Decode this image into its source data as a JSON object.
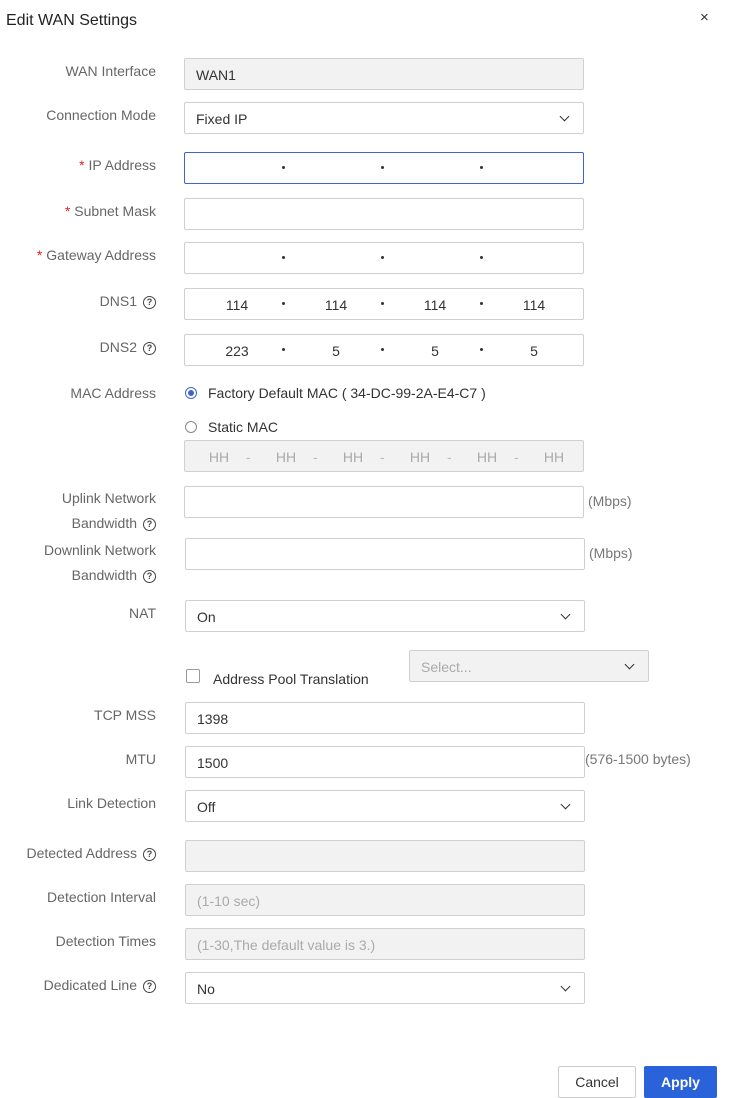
{
  "dialog": {
    "title": "Edit WAN Settings",
    "close_glyph": "×"
  },
  "fields": {
    "wan_interface": {
      "label": "WAN Interface",
      "value": "WAN1"
    },
    "connection_mode": {
      "label": "Connection Mode",
      "value": "Fixed IP"
    },
    "ip_address": {
      "required": "*",
      "label": "IP Address",
      "octets": [
        "",
        "",
        "",
        ""
      ]
    },
    "subnet_mask": {
      "required": "*",
      "label": "Subnet Mask",
      "value": ""
    },
    "gateway": {
      "required": "*",
      "label": "Gateway Address",
      "octets": [
        "",
        "",
        "",
        ""
      ]
    },
    "dns1": {
      "label": "DNS1",
      "help": "?",
      "octets": [
        "114",
        "114",
        "114",
        "114"
      ]
    },
    "dns2": {
      "label": "DNS2",
      "help": "?",
      "octets": [
        "223",
        "5",
        "5",
        "5"
      ]
    },
    "mac": {
      "label": "MAC Address",
      "option_default": "Factory Default MAC ( 34-DC-99-2A-E4-C7 )",
      "option_static": "Static MAC",
      "selected": "default",
      "placeholders": [
        "HH",
        "HH",
        "HH",
        "HH",
        "HH",
        "HH"
      ],
      "separator": "-"
    },
    "uplink": {
      "label_line1": "Uplink Network",
      "label_line2": "Bandwidth",
      "help": "?",
      "value": "",
      "unit": "(Mbps)"
    },
    "downlink": {
      "label_line1": "Downlink Network",
      "label_line2": "Bandwidth",
      "help": "?",
      "value": "",
      "unit": "(Mbps)"
    },
    "nat": {
      "label": "NAT",
      "value": "On"
    },
    "address_pool": {
      "label": "Address Pool Translation",
      "checked": false,
      "select_placeholder": "Select..."
    },
    "tcp_mss": {
      "label": "TCP MSS",
      "value": "1398"
    },
    "mtu": {
      "label": "MTU",
      "value": "1500",
      "unit": "(576-1500 bytes)"
    },
    "link_detection": {
      "label": "Link Detection",
      "value": "Off"
    },
    "detected_address": {
      "label": "Detected Address",
      "help": "?",
      "value": ""
    },
    "detection_interval": {
      "label": "Detection Interval",
      "placeholder": "(1-10 sec)"
    },
    "detection_times": {
      "label": "Detection Times",
      "placeholder": "(1-30,The default value is 3.)"
    },
    "dedicated_line": {
      "label": "Dedicated Line",
      "help": "?",
      "value": "No"
    }
  },
  "footer": {
    "cancel_label": "Cancel",
    "apply_label": "Apply"
  },
  "colors": {
    "accent": "#2a63d9",
    "required": "#e02020",
    "focus_border": "#3e66c8",
    "disabled_bg": "#f2f2f2"
  },
  "icons": {
    "close": "close-icon",
    "help": "help-circle-icon",
    "dropdown": "chevron-down-icon"
  }
}
